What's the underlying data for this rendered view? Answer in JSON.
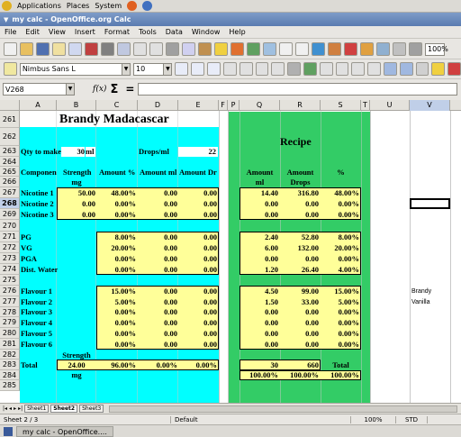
{
  "gnome": {
    "applications": "Applications",
    "places": "Places",
    "system": "System"
  },
  "window": {
    "title": "my calc - OpenOffice.org Calc"
  },
  "menu": [
    "File",
    "Edit",
    "View",
    "Insert",
    "Format",
    "Tools",
    "Data",
    "Window",
    "Help"
  ],
  "format": {
    "font": "Nimbus Sans L",
    "size": "10",
    "zoom": "100%"
  },
  "formula": {
    "cellref": "V268",
    "fx": "f(x)",
    "sigma": "Σ",
    "eq": "="
  },
  "columns": [
    "A",
    "B",
    "C",
    "D",
    "E",
    "F",
    "P",
    "Q",
    "R",
    "S",
    "T",
    "U",
    "V"
  ],
  "sheet": {
    "title": "Brandy Madacascar",
    "recipe": "Recipe",
    "qty_label": "Qty to make",
    "qty_value": "30",
    "qty_unit": "ml",
    "drops_label": "Drops/ml",
    "drops_value": "22",
    "h_component": "Component",
    "h_strength": "Strength",
    "h_mg": "mg",
    "h_amount_pct": "Amount %",
    "h_amount_ml": "Amount ml",
    "h_amount_dr": "Amount Dr",
    "h_r_amount": "Amount",
    "h_r_ml": "ml",
    "h_r_amount2": "Amount",
    "h_r_drops": "Drops",
    "h_r_pct": "%",
    "nic": [
      {
        "name": "Nicotine 1",
        "strength": "50.00",
        "pct": "48.00%",
        "ml": "0.00",
        "dr": "0.00",
        "q": "14.40",
        "r": "316.80",
        "s": "48.00%"
      },
      {
        "name": "Nicotine 2",
        "strength": "0.00",
        "pct": "0.00%",
        "ml": "0.00",
        "dr": "0.00",
        "q": "0.00",
        "r": "0.00",
        "s": "0.00%"
      },
      {
        "name": "Nicotine 3",
        "strength": "0.00",
        "pct": "0.00%",
        "ml": "0.00",
        "dr": "0.00",
        "q": "0.00",
        "r": "0.00",
        "s": "0.00%"
      }
    ],
    "base": [
      {
        "name": "PG",
        "pct": "8.00%",
        "ml": "0.00",
        "dr": "0.00",
        "q": "2.40",
        "r": "52.80",
        "s": "8.00%"
      },
      {
        "name": "VG",
        "pct": "20.00%",
        "ml": "0.00",
        "dr": "0.00",
        "q": "6.00",
        "r": "132.00",
        "s": "20.00%"
      },
      {
        "name": "PGA",
        "pct": "0.00%",
        "ml": "0.00",
        "dr": "0.00",
        "q": "0.00",
        "r": "0.00",
        "s": "0.00%"
      },
      {
        "name": "Dist. Water",
        "pct": "0.00%",
        "ml": "0.00",
        "dr": "0.00",
        "q": "1.20",
        "r": "26.40",
        "s": "4.00%"
      }
    ],
    "flav": [
      {
        "name": "Flavour 1",
        "pct": "15.00%",
        "ml": "0.00",
        "dr": "0.00",
        "q": "4.50",
        "r": "99.00",
        "s": "15.00%",
        "v": "Brandy"
      },
      {
        "name": "Flavour 2",
        "pct": "5.00%",
        "ml": "0.00",
        "dr": "0.00",
        "q": "1.50",
        "r": "33.00",
        "s": "5.00%",
        "v": "Vanilla"
      },
      {
        "name": "Flavour 3",
        "pct": "0.00%",
        "ml": "0.00",
        "dr": "0.00",
        "q": "0.00",
        "r": "0.00",
        "s": "0.00%",
        "v": ""
      },
      {
        "name": "Flavour 4",
        "pct": "0.00%",
        "ml": "0.00",
        "dr": "0.00",
        "q": "0.00",
        "r": "0.00",
        "s": "0.00%",
        "v": ""
      },
      {
        "name": "Flavour 5",
        "pct": "0.00%",
        "ml": "0.00",
        "dr": "0.00",
        "q": "0.00",
        "r": "0.00",
        "s": "0.00%",
        "v": ""
      },
      {
        "name": "Flavour 6",
        "pct": "0.00%",
        "ml": "0.00",
        "dr": "0.00",
        "q": "0.00",
        "r": "0.00",
        "s": "0.00%",
        "v": ""
      }
    ],
    "total_label": "Total",
    "total_strength_label": "Strength",
    "total_strength": "24.00",
    "total_mg": "mg",
    "total_pct": "96.00%",
    "total_d": "0.00%",
    "total_e": "0.00%",
    "total_q": "30",
    "total_r": "660",
    "total_s_label": "Total",
    "total_q2": "100.00%",
    "total_r2": "100.00%",
    "total_s2": "100.00%"
  },
  "rows": [
    "261",
    "262",
    "263",
    "264",
    "265",
    "266",
    "267",
    "268",
    "269",
    "270",
    "271",
    "272",
    "273",
    "274",
    "275",
    "276",
    "277",
    "278",
    "279",
    "280",
    "281",
    "282",
    "283",
    "284",
    "285"
  ],
  "tabs": [
    "Sheet1",
    "Sheet2",
    "Sheet3"
  ],
  "status": {
    "sheet": "Sheet 2 / 3",
    "style": "Default",
    "zoom": "100%",
    "mode": "STD"
  },
  "taskbar": {
    "item": "my calc - OpenOffice...."
  }
}
